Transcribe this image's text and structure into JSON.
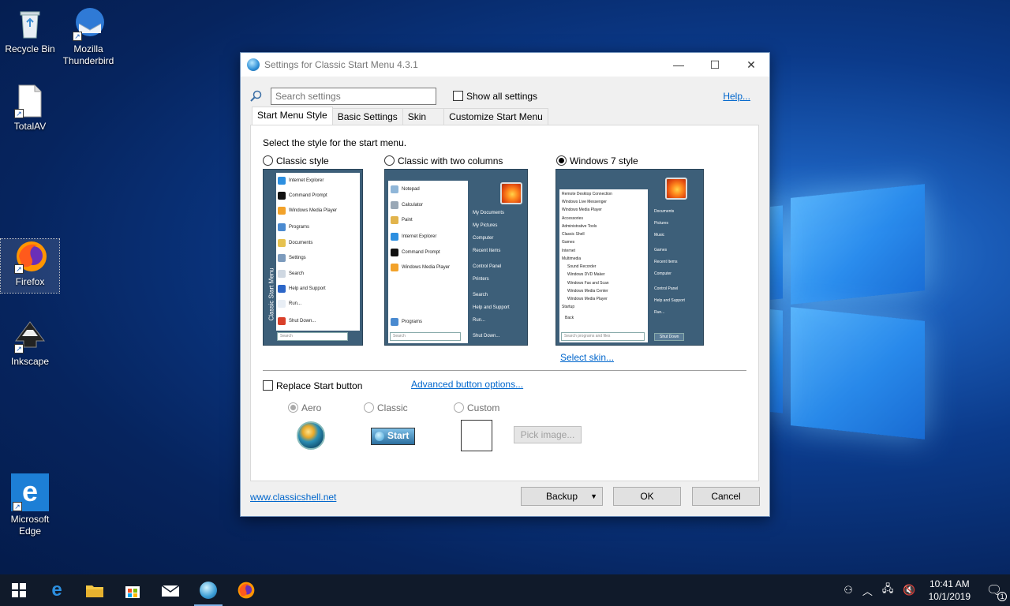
{
  "desktop": {
    "icons": [
      {
        "label": "Recycle Bin"
      },
      {
        "label": "Mozilla Thunderbird"
      },
      {
        "label": "TotalAV"
      },
      {
        "label": "Firefox"
      },
      {
        "label": "Inkscape"
      },
      {
        "label": "Microsoft Edge"
      }
    ]
  },
  "window": {
    "title": "Settings for Classic Start Menu 4.3.1",
    "controls": {
      "minimize": "—",
      "maximize": "☐",
      "close": "✕"
    },
    "search": {
      "placeholder": "Search settings"
    },
    "show_all_label": "Show all settings",
    "help_label": "Help...",
    "tabs": [
      "Start Menu Style",
      "Basic Settings",
      "Skin",
      "Customize Start Menu"
    ],
    "active_tab": "Start Menu Style",
    "lead": "Select the style for the start menu.",
    "styles": [
      {
        "label": "Classic style",
        "selected": false
      },
      {
        "label": "Classic with two columns",
        "selected": false
      },
      {
        "label": "Windows 7 style",
        "selected": true
      }
    ],
    "preview_classic": {
      "side_label": "Classic Start Menu",
      "items": [
        "Internet Explorer",
        "Command Prompt",
        "Windows Media Player",
        "Programs",
        "Documents",
        "Settings",
        "Search",
        "Help and Support",
        "Run...",
        "Shut Down..."
      ],
      "search": "Search"
    },
    "preview_two_col": {
      "left_items": [
        "Notepad",
        "Calculator",
        "Paint",
        "Internet Explorer",
        "Command Prompt",
        "Windows Media Player"
      ],
      "programs": "Programs",
      "search": "Search",
      "right_items": [
        "My Documents",
        "My Pictures",
        "Computer",
        "Recent Items",
        "Control Panel",
        "Printers",
        "Search",
        "Help and Support",
        "Run...",
        "Shut Down..."
      ]
    },
    "preview_win7": {
      "left_items": [
        "Remote Desktop Connection",
        "Windows Live Messenger",
        "Windows Media Player",
        "Accessories",
        "Administrative Tools",
        "Classic Shell",
        "Games",
        "Internet",
        "Multimedia",
        "Sound Recorder",
        "Windows DVD Maker",
        "Windows Fax and Scan",
        "Windows Media Center",
        "Windows Media Player",
        "Startup"
      ],
      "back": "Back",
      "search": "Search programs and files",
      "right_items": [
        "Documents",
        "Pictures",
        "Music",
        "Games",
        "Recent Items",
        "Computer",
        "Control Panel",
        "Help and Support",
        "Run..."
      ],
      "shutdown": "Shut Down"
    },
    "select_skin": "Select skin...",
    "replace_start_label": "Replace Start button",
    "advanced_link": "Advanced button options...",
    "button_styles": [
      {
        "label": "Aero",
        "selected": true
      },
      {
        "label": "Classic",
        "selected": false
      },
      {
        "label": "Custom",
        "selected": false
      }
    ],
    "start_button_text": "Start",
    "pick_image": "Pick image...",
    "website": "www.classicshell.net",
    "backup": "Backup",
    "ok": "OK",
    "cancel": "Cancel"
  },
  "taskbar": {
    "time": "10:41 AM",
    "date": "10/1/2019",
    "notification_count": "1"
  }
}
